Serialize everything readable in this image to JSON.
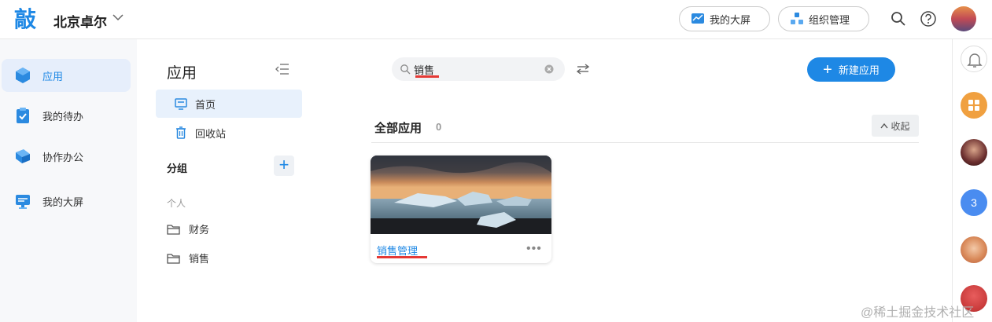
{
  "header": {
    "logo_char": "敲",
    "org_name": "北京卓尔",
    "big_screen_label": "我的大屏",
    "org_manage_label": "组织管理"
  },
  "leftnav": {
    "items": [
      {
        "label": "应用",
        "icon": "app-cube-icon",
        "active": true
      },
      {
        "label": "我的待办",
        "icon": "todo-clipboard-icon"
      },
      {
        "label": "协作办公",
        "icon": "collab-icon"
      },
      {
        "label": "我的大屏",
        "icon": "screen-icon"
      }
    ]
  },
  "panel": {
    "title": "应用",
    "home_label": "首页",
    "recycle_label": "回收站",
    "group_label": "分组",
    "add_symbol": "+",
    "personal_label": "个人",
    "folders": [
      "财务",
      "销售"
    ]
  },
  "main": {
    "search": {
      "value": "销售"
    },
    "new_app_plus": "+",
    "new_app_label": "新建应用",
    "section_title": "全部应用",
    "section_count": "0",
    "collapse_label": "收起",
    "cards": [
      {
        "name": "销售管理",
        "more": "•••"
      }
    ]
  },
  "rightbar": {
    "badge_number": "3"
  },
  "watermark": "@稀土掘金技术社区",
  "colors": {
    "accent": "#1e88e5",
    "highlight_underline": "#e53935",
    "nav_active_bg": "#e6eefb"
  }
}
